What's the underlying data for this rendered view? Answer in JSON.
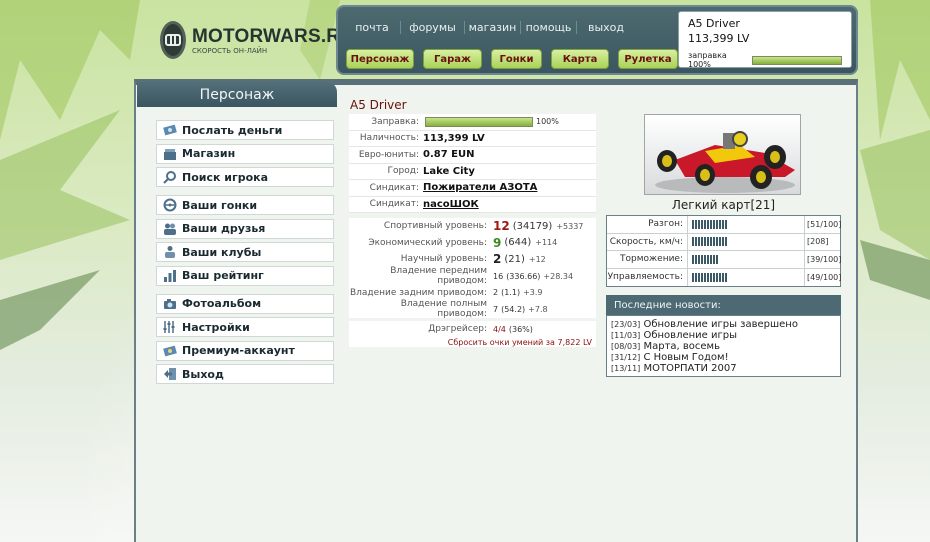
{
  "logo": {
    "title": "MOTORWARS.RU",
    "subtitle": "СКОРОСТЬ ОН-ЛАЙН"
  },
  "topnav": {
    "links": [
      "почта",
      "форумы",
      "магазин",
      "помощь",
      "выход"
    ],
    "buttons": [
      "Персонаж",
      "Гараж",
      "Гонки",
      "Карта",
      "Рулетка"
    ]
  },
  "user": {
    "name": "A5 Driver",
    "money": "113,399 LV",
    "fuel_label": "заправка 100%",
    "fuel_level": 1.0
  },
  "panel": {
    "title": "Персонаж"
  },
  "sidebar": {
    "groups": [
      [
        {
          "label": "Послать деньги",
          "icon": "money-icon"
        },
        {
          "label": "Магазин",
          "icon": "shop-icon"
        },
        {
          "label": "Поиск игрока",
          "icon": "search-icon"
        }
      ],
      [
        {
          "label": "Ваши гонки",
          "icon": "steering-wheel-icon"
        },
        {
          "label": "Ваши друзья",
          "icon": "friends-icon"
        },
        {
          "label": "Ваши клубы",
          "icon": "clubs-icon"
        },
        {
          "label": "Ваш рейтинг",
          "icon": "rating-icon"
        }
      ],
      [
        {
          "label": "Фотоальбом",
          "icon": "camera-icon"
        },
        {
          "label": "Настройки",
          "icon": "sliders-icon"
        },
        {
          "label": "Премиум-аккаунт",
          "icon": "premium-icon"
        },
        {
          "label": "Выход",
          "icon": "exit-icon"
        }
      ]
    ]
  },
  "profile": {
    "driver": "A5 Driver",
    "fuel": {
      "label": "Заправка:",
      "value": "100%",
      "level": 1.0
    },
    "rows": [
      {
        "label": "Наличность:",
        "value": "113,399 LV"
      },
      {
        "label": "Евро-юниты:",
        "value": "0.87 EUN"
      },
      {
        "label": "Город:",
        "value": "Lake City"
      },
      {
        "label": "Синдикат:",
        "value": "Пожиратели АЗОТА",
        "link": true
      },
      {
        "label": "Синдикат:",
        "value": "nacoШОК",
        "link": true
      }
    ],
    "levels": [
      {
        "label": "Спортивный уровень:",
        "value": "12",
        "sub": "(34179)",
        "plus": "+5337",
        "color": "#a01818"
      },
      {
        "label": "Экономический уровень:",
        "value": "9",
        "sub": "(644)",
        "plus": "+114",
        "color": "#3a8a22"
      },
      {
        "label": "Научный уровень:",
        "value": "2",
        "sub": "(21)",
        "plus": "+12",
        "color": "#222222"
      }
    ],
    "drives": [
      {
        "label": "Владение передним приводом:",
        "value": "16",
        "sub": "(336.66)",
        "plus": "+28.34"
      },
      {
        "label": "Владение задним приводом:",
        "value": "2",
        "sub": "(1.1)",
        "plus": "+3.9"
      },
      {
        "label": "Владение полным приводом:",
        "value": "7",
        "sub": "(54.2)",
        "plus": "+7.8"
      }
    ],
    "drag": {
      "label": "Дрэгрейсер:",
      "value": "4/4",
      "sub": "(36%)"
    },
    "reset": "Сбросить очки умений за 7,822 LV"
  },
  "car": {
    "name": "Легкий карт[21]",
    "stats": [
      {
        "label": "Разгон:",
        "value": "[51/100]",
        "level": 0.51
      },
      {
        "label": "Скорость, км/ч:",
        "value": "[208]",
        "level": 0.51
      },
      {
        "label": "Торможение:",
        "value": "[39/100]",
        "level": 0.39
      },
      {
        "label": "Управляемость:",
        "value": "[49/100]",
        "level": 0.49
      }
    ]
  },
  "news": {
    "title": "Последние новости:",
    "items": [
      {
        "date": "[23/03]",
        "text": "Обновление игры завершено"
      },
      {
        "date": "[11/03]",
        "text": "Обновление игры"
      },
      {
        "date": "[08/03]",
        "text": "Марта, восемь"
      },
      {
        "date": "[31/12]",
        "text": "С Новым Годом!"
      },
      {
        "date": "[13/11]",
        "text": "МОТОРПАТИ 2007"
      }
    ]
  }
}
